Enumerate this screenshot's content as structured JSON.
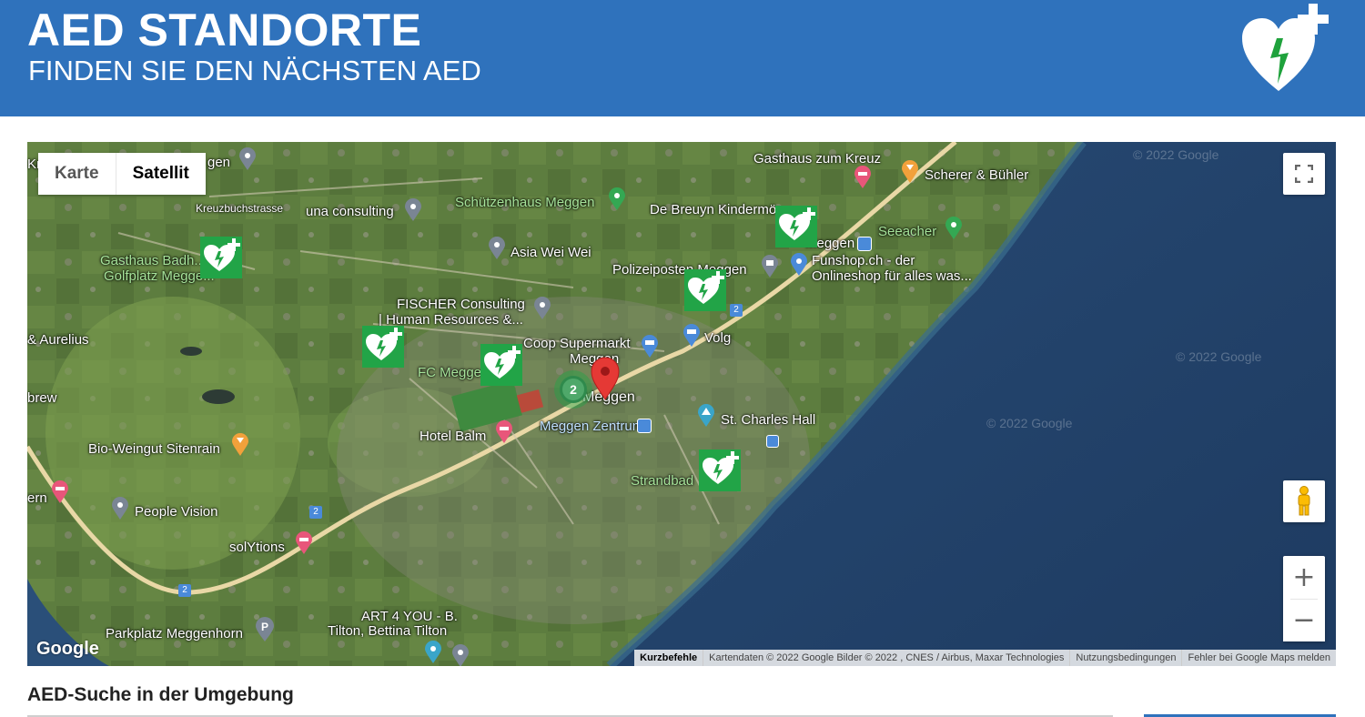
{
  "header": {
    "title": "AED STANDORTE",
    "subtitle": "FINDEN SIE DEN NÄCHSTEN AED",
    "logo_icon": "aed-heart-logo-icon",
    "bg_color": "#2f72bc"
  },
  "map": {
    "map_type_buttons": {
      "map": "Karte",
      "satellite": "Satellit"
    },
    "google_logo": "Google",
    "attribution": {
      "shortcuts": "Kurzbefehle",
      "data": "Kartendaten © 2022 Google Bilder © 2022 , CNES / Airbus, Maxar Technologies",
      "terms": "Nutzungsbedingungen",
      "report": "Fehler bei Google Maps melden"
    },
    "watermark": "© 2022 Google",
    "cluster_count": "2",
    "place_labels": {
      "p1": "Gasthaus zum Kreuz",
      "p2": "Scherer & Bühler",
      "p3": "Kreuzbuchstrasse",
      "p4": "una consulting",
      "p5": "Schützenhaus Meggen",
      "p6": "De Breuyn Kindermö...",
      "p7": "Seeacher",
      "p8": "Gasthaus Badh...",
      "p9": "Golfplatz Megge...",
      "p10": "Asia Wei Wei",
      "p11": "Polizeiposten Meggen",
      "p12": "Meggen",
      "p13": "Funshop.ch - der",
      "p14": "Onlineshop für alles was...",
      "p15": "FISCHER Consulting",
      "p16": "| Human Resources &...",
      "p17": "& Aurelius",
      "p18": "Coop Supermarkt",
      "p19": "Meggen",
      "p20": "Volg",
      "p21": "FC Megge...",
      "p22": "brew",
      "p23": "Meggen",
      "p24": "St. Charles Hall",
      "p25": "Hotel Balm",
      "p26": "Meggen Zentrum",
      "p27": "Bio-Weingut Sitenrain",
      "p28": "Strandbad",
      "p29": "ern",
      "p30": "People Vision",
      "p31": "solYtions",
      "p32": "ART 4 YOU - B.",
      "p33": "Tilton, Bettina Tilton",
      "p34": "Parkplatz Meggenhorn",
      "p35": "gen",
      "p36": "Kr"
    },
    "route_badge": "2"
  },
  "bottom": {
    "section_title": "AED-Suche in der Umgebung"
  }
}
